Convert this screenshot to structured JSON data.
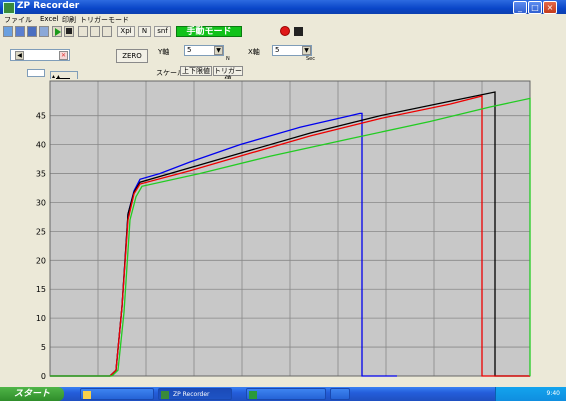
{
  "window": {
    "title": "ZP Recorder",
    "controls": {
      "minimize": "_",
      "maximize": "□",
      "close": "×"
    }
  },
  "menu": {
    "file": "ファイル",
    "excel": "Excel",
    "print": "印刷",
    "trigger": "トリガーモード"
  },
  "toolbar": {
    "xpl_label": "Xpl",
    "n_label": "N",
    "snf_label": "snf",
    "manual_mode_label": "手動モード"
  },
  "panel": {
    "zero_button": "ZERO",
    "y_axis_label": "Y軸",
    "y_axis_value": "5",
    "y_unit": "N",
    "x_axis_label": "X軸",
    "x_axis_value": "5",
    "x_unit": "Sec",
    "scale_label": "スケール",
    "upper_lower_tab": "上下限値",
    "trigger_value_tab": "トリガー値"
  },
  "colors": {
    "plot_bg": "#c8c8c8",
    "grid": "#888888",
    "manual_mode": "#11c21a",
    "record_red": "#e01818"
  },
  "chart_data": {
    "type": "line",
    "yticks": [
      "0",
      "5",
      "10",
      "15",
      "20",
      "25",
      "30",
      "35",
      "40",
      "45"
    ],
    "ylim": [
      0,
      51
    ],
    "xlim": [
      0,
      480
    ],
    "series": [
      {
        "color": "#0000ee",
        "points": [
          [
            0,
            0
          ],
          [
            60,
            0
          ],
          [
            66,
            1
          ],
          [
            72,
            12
          ],
          [
            78,
            28
          ],
          [
            84,
            32
          ],
          [
            90,
            34
          ],
          [
            110,
            35
          ],
          [
            140,
            37
          ],
          [
            190,
            40
          ],
          [
            250,
            43
          ],
          [
            300,
            45
          ],
          [
            310,
            45.4
          ],
          [
            312,
            45.4
          ],
          [
            312,
            0
          ],
          [
            347,
            0
          ]
        ]
      },
      {
        "color": "#000000",
        "points": [
          [
            0,
            0
          ],
          [
            60,
            0
          ],
          [
            66,
            1
          ],
          [
            72,
            12
          ],
          [
            78,
            28
          ],
          [
            84,
            31.8
          ],
          [
            90,
            33.5
          ],
          [
            140,
            36
          ],
          [
            200,
            39
          ],
          [
            260,
            42
          ],
          [
            330,
            45
          ],
          [
            400,
            47.5
          ],
          [
            445,
            49.1
          ],
          [
            445,
            0
          ],
          [
            480,
            0
          ]
        ]
      },
      {
        "color": "#ee0000",
        "points": [
          [
            0,
            0
          ],
          [
            60,
            0
          ],
          [
            66,
            1
          ],
          [
            72,
            12
          ],
          [
            78,
            27
          ],
          [
            84,
            31.5
          ],
          [
            90,
            33.2
          ],
          [
            140,
            35.5
          ],
          [
            200,
            38.5
          ],
          [
            260,
            41.5
          ],
          [
            330,
            44.5
          ],
          [
            400,
            47
          ],
          [
            432,
            48.4
          ],
          [
            432,
            0
          ],
          [
            480,
            0
          ]
        ]
      },
      {
        "color": "#22cc22",
        "points": [
          [
            0,
            0
          ],
          [
            62,
            0
          ],
          [
            68,
            1
          ],
          [
            74,
            11
          ],
          [
            80,
            27
          ],
          [
            86,
            31
          ],
          [
            92,
            32.8
          ],
          [
            150,
            35
          ],
          [
            220,
            38
          ],
          [
            300,
            41
          ],
          [
            380,
            44
          ],
          [
            440,
            46.5
          ],
          [
            480,
            48
          ],
          [
            480,
            0
          ]
        ]
      }
    ]
  }
}
